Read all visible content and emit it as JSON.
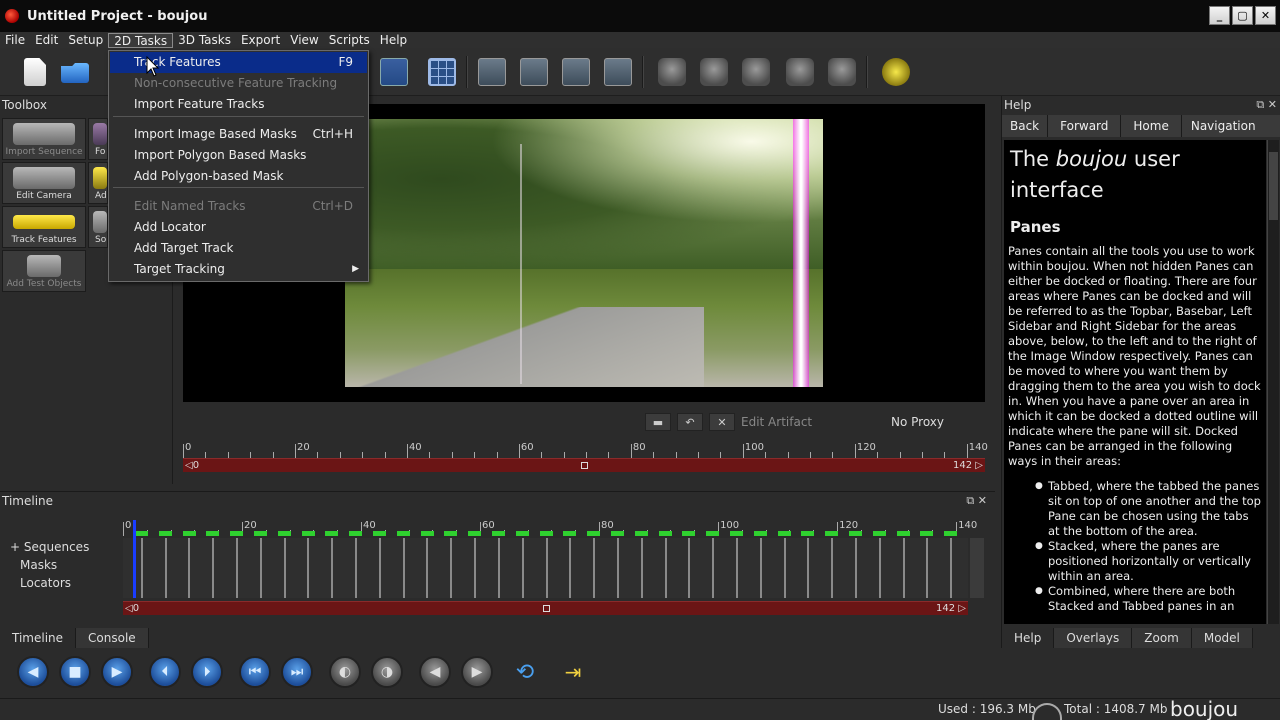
{
  "window": {
    "title": "Untitled Project - boujou",
    "controls": [
      "_",
      "▢",
      "✕"
    ]
  },
  "menubar": [
    "File",
    "Edit",
    "Setup",
    "2D Tasks",
    "3D Tasks",
    "Export",
    "View",
    "Scripts",
    "Help"
  ],
  "dropdown": {
    "items": [
      {
        "label": "Track Features",
        "shortcut": "F9",
        "state": "selected"
      },
      {
        "label": "Non-consecutive Feature Tracking",
        "shortcut": "",
        "state": "disabled"
      },
      {
        "label": "Import Feature Tracks",
        "shortcut": "",
        "state": "normal"
      },
      {
        "label": "Import Image Based Masks",
        "shortcut": "Ctrl+H",
        "state": "normal"
      },
      {
        "label": "Import Polygon Based Masks",
        "shortcut": "",
        "state": "normal"
      },
      {
        "label": "Add Polygon-based Mask",
        "shortcut": "",
        "state": "normal"
      },
      {
        "label": "Edit Named Tracks",
        "shortcut": "Ctrl+D",
        "state": "disabled"
      },
      {
        "label": "Add Locator",
        "shortcut": "",
        "state": "normal"
      },
      {
        "label": "Add Target Track",
        "shortcut": "",
        "state": "normal"
      },
      {
        "label": "Target Tracking",
        "shortcut": "",
        "state": "submenu"
      }
    ]
  },
  "toolbox": {
    "title": "Toolbox",
    "tools": [
      {
        "label": "Import Sequence",
        "icon": "film-camera-icon"
      },
      {
        "label": "Fo",
        "icon": "focus-icon"
      },
      {
        "label": "Edit Camera",
        "icon": "camera-icon"
      },
      {
        "label": "Ad",
        "icon": "add-icon"
      },
      {
        "label": "Track Features",
        "icon": "track-features-icon"
      },
      {
        "label": "So",
        "icon": "solve-icon"
      },
      {
        "label": "Add Test Objects",
        "icon": "test-objects-icon"
      }
    ]
  },
  "image_window": {
    "edit_artifact": "Edit Artifact",
    "proxy": "No Proxy",
    "ruler_labels": [
      "0",
      "20",
      "40",
      "60",
      "80",
      "100",
      "120",
      "140"
    ],
    "range_start": "0",
    "range_end": "142"
  },
  "timeline": {
    "title": "Timeline",
    "tree": [
      "Sequences",
      "Masks",
      "Locators"
    ],
    "ruler_labels": [
      "0",
      "20",
      "40",
      "60",
      "80",
      "100",
      "120",
      "140"
    ],
    "range_start": "0",
    "range_end": "142",
    "tabs": [
      "Timeline",
      "Console"
    ]
  },
  "help": {
    "title": "Help",
    "nav": [
      "Back",
      "Forward",
      "Home",
      "Navigation Help"
    ],
    "heading_pre": "The ",
    "heading_em": "boujou",
    "heading_post": " user interface",
    "subheading": "Panes",
    "paragraph": "Panes contain all the tools you use to work within boujou. When not hidden Panes can either be docked or floating. There are four areas where Panes can be docked and will be referred to as the Topbar, Basebar, Left Sidebar and Right Sidebar for the areas above, below, to the left and to the right of the Image Window respectively. Panes can be moved to where you want them by dragging them to the area you wish to dock in. When you have a pane over an area in which it can be docked a dotted outline will indicate where the pane will sit. Docked Panes can be arranged in the following ways in their areas:",
    "bullets": [
      "Tabbed, where the tabbed the panes sit on top of one another and the top Pane can be chosen using the tabs at the bottom of the area.",
      "Stacked, where the panes are positioned horizontally or vertically within an area.",
      "Combined, where there are both Stacked and Tabbed panes in an"
    ],
    "tabs": [
      "Help",
      "Overlays",
      "Zoom",
      "Model"
    ]
  },
  "status": {
    "used": "Used : 196.3 Mb",
    "total": "Total : 1408.7 Mb",
    "brand": "boujou"
  },
  "colors": {
    "menu_highlight": "#0a2c8a",
    "scrub_bar": "#6b1515",
    "tracking_marks": "#2fd12f",
    "playhead": "#1a3dff"
  }
}
